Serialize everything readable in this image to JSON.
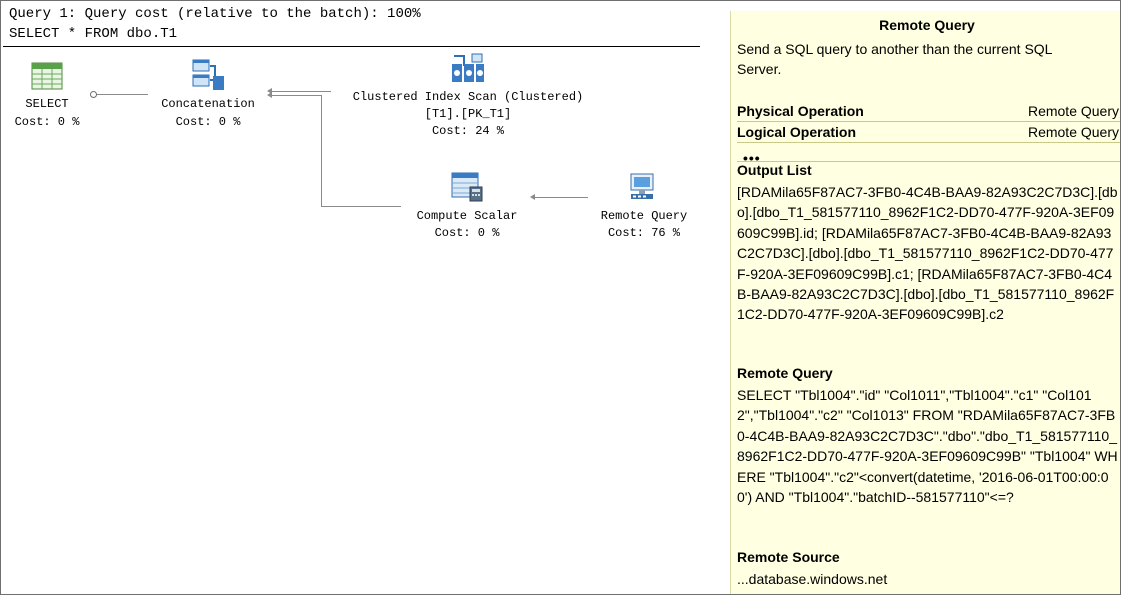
{
  "header": {
    "line1": "Query 1: Query cost (relative to the batch): 100%",
    "line2": "SELECT * FROM dbo.T1"
  },
  "nodes": {
    "select": {
      "name": "SELECT",
      "cost": "Cost: 0 %",
      "icon": "select-table-icon"
    },
    "concat": {
      "name": "Concatenation",
      "cost": "Cost: 0 %",
      "icon": "concatenation-icon"
    },
    "scan": {
      "name": "Clustered Index Scan (Clustered)",
      "object": "[T1].[PK_T1]",
      "cost": "Cost: 24 %",
      "icon": "clustered-index-scan-icon"
    },
    "compute": {
      "name": "Compute Scalar",
      "cost": "Cost: 0 %",
      "icon": "compute-scalar-icon"
    },
    "remote": {
      "name": "Remote Query",
      "cost": "Cost: 76 %",
      "icon": "remote-query-icon"
    }
  },
  "tooltip": {
    "title": "Remote Query",
    "description": "Send a SQL query to another than the current SQL Server.",
    "physical_label": "Physical Operation",
    "physical_value": "Remote Query",
    "logical_label": "Logical Operation",
    "logical_value": "Remote Query",
    "ellipsis": "•••",
    "output_list_label": "Output List",
    "output_list": "[RDAMila65F87AC7-3FB0-4C4B-BAA9-82A93C2C7D3C].[dbo].[dbo_T1_581577110_8962F1C2-DD70-477F-920A-3EF09609C99B].id; [RDAMila65F87AC7-3FB0-4C4B-BAA9-82A93C2C7D3C].[dbo].[dbo_T1_581577110_8962F1C2-DD70-477F-920A-3EF09609C99B].c1; [RDAMila65F87AC7-3FB0-4C4B-BAA9-82A93C2C7D3C].[dbo].[dbo_T1_581577110_8962F1C2-DD70-477F-920A-3EF09609C99B].c2",
    "remote_query_label": "Remote Query",
    "remote_query": "SELECT \"Tbl1004\".\"id\" \"Col1011\",\"Tbl1004\".\"c1\" \"Col1012\",\"Tbl1004\".\"c2\" \"Col1013\" FROM \"RDAMila65F87AC7-3FB0-4C4B-BAA9-82A93C2C7D3C\".\"dbo\".\"dbo_T1_581577110_8962F1C2-DD70-477F-920A-3EF09609C99B\" \"Tbl1004\" WHERE \"Tbl1004\".\"c2\"<convert(datetime, '2016-06-01T00:00:00') AND \"Tbl1004\".\"batchID--581577110\"<=?",
    "remote_source_label": "Remote Source",
    "remote_source": "...database.windows.net"
  },
  "colors": {
    "tooltip_bg": "#ffffe1",
    "connector": "#8a8a8a"
  }
}
